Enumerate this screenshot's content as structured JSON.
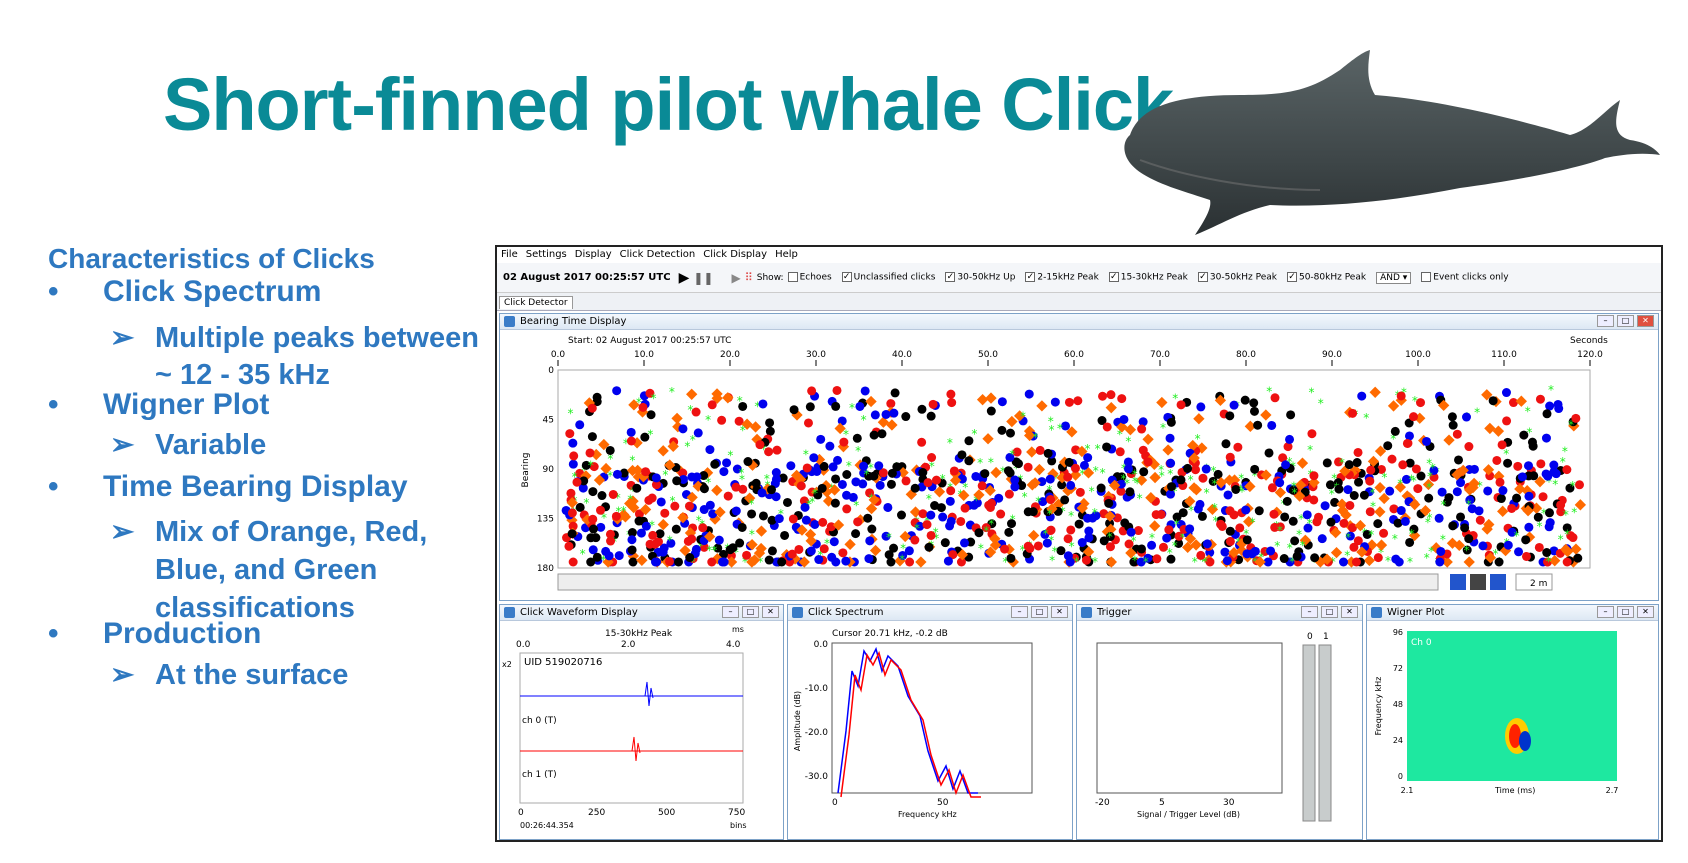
{
  "slide": {
    "title": "Short-finned pilot whale Click",
    "section_heading": "Characteristics of Clicks",
    "bullets": [
      {
        "label": "Click Spectrum",
        "subs": [
          "Multiple peaks between",
          "~ 12 - 35 kHz"
        ]
      },
      {
        "label": "Wigner Plot",
        "subs": [
          "Variable"
        ]
      },
      {
        "label": "Time Bearing Display",
        "subs": [
          "Mix of Orange, Red,",
          "Blue, and Green",
          "classifications"
        ]
      },
      {
        "label": "Production",
        "subs": [
          "At the surface"
        ]
      }
    ],
    "bullet_char": "•",
    "arrow_char": "➢",
    "colors": {
      "title": "#0a8a96",
      "text": "#2e78c0"
    }
  },
  "app": {
    "menu": [
      "File",
      "Settings",
      "Display",
      "Click Detection",
      "Click Display",
      "Help"
    ],
    "toolbar": {
      "datetime": "02 August 2017 00:25:57 UTC",
      "show_label": "Show:",
      "checks": [
        {
          "label": "Echoes",
          "checked": false
        },
        {
          "label": "Unclassified clicks",
          "checked": true
        },
        {
          "label": "30-50kHz Up",
          "checked": true
        },
        {
          "label": "2-15kHz Peak",
          "checked": true
        },
        {
          "label": "15-30kHz Peak",
          "checked": true
        },
        {
          "label": "30-50kHz Peak",
          "checked": true
        },
        {
          "label": "50-80kHz Peak",
          "checked": true
        }
      ],
      "logic": "AND",
      "event_only": "Event clicks only"
    },
    "tab": "Click Detector",
    "bearing": {
      "title": "Bearing Time Display",
      "start": "Start: 02 August 2017 00:25:57 UTC",
      "seconds_label": "Seconds",
      "x_ticks": [
        "0.0",
        "10.0",
        "20.0",
        "30.0",
        "40.0",
        "50.0",
        "60.0",
        "70.0",
        "80.0",
        "90.0",
        "100.0",
        "110.0",
        "120.0"
      ],
      "y_ticks": [
        "0",
        "45",
        "90",
        "135",
        "180"
      ],
      "ylabel": "Bearing",
      "span": "2 m",
      "colors": {
        "blue": "#0000ee",
        "red": "#ee1111",
        "orange": "#ff6a00",
        "black": "#000000",
        "green": "#22ee22"
      }
    },
    "waveform": {
      "title": "Click Waveform Display",
      "peak": "15-30kHz Peak",
      "ms": "ms",
      "top_ticks": [
        "0.0",
        "2.0",
        "4.0"
      ],
      "uid": "UID 519020716",
      "x2": "x2",
      "ch0": "ch 0 (T)",
      "ch1": "ch 1 (T)",
      "bottom_ticks": [
        "0",
        "250",
        "500",
        "750"
      ],
      "time": "00:26:44.354",
      "bins": "bins"
    },
    "spectrum": {
      "title": "Click Spectrum",
      "cursor": "Cursor 20.71 kHz, -0.2 dB",
      "y_ticks": [
        "0.0",
        "-10.0",
        "-20.0",
        "-30.0"
      ],
      "x_ticks": [
        "0",
        "50"
      ],
      "ylabel": "Amplitude (dB)",
      "xlabel": "Frequency kHz"
    },
    "trigger": {
      "title": "Trigger",
      "x_ticks": [
        "-20",
        "5",
        "30"
      ],
      "xlabel": "Signal / Trigger Level (dB)",
      "bar_labels": [
        "0",
        "1"
      ]
    },
    "wigner": {
      "title": "Wigner Plot",
      "ch": "Ch 0",
      "y_ticks": [
        "96",
        "72",
        "48",
        "24",
        "0"
      ],
      "ylabel": "Frequency kHz",
      "x_ticks": [
        "2.1",
        "2.7"
      ],
      "xlabel": "Time (ms)"
    }
  }
}
